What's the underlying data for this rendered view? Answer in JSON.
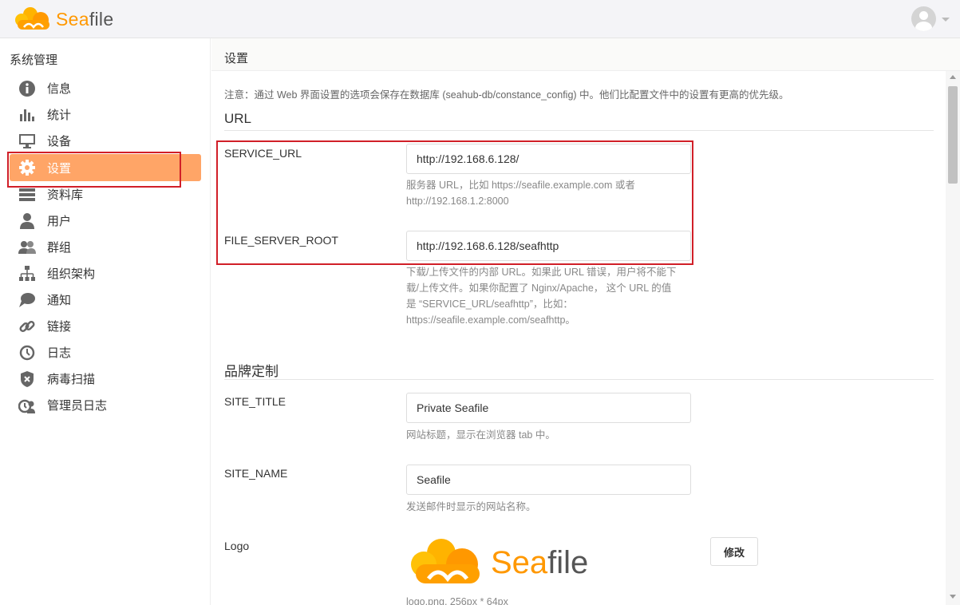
{
  "app": {
    "name_prefix": "Sea",
    "name_suffix": "file"
  },
  "sidebar": {
    "heading": "系统管理",
    "items": [
      {
        "label": "信息",
        "icon": "info-icon"
      },
      {
        "label": "统计",
        "icon": "bar-chart-icon"
      },
      {
        "label": "设备",
        "icon": "monitor-icon"
      },
      {
        "label": "设置",
        "icon": "gear-icon",
        "active": true
      },
      {
        "label": "资料库",
        "icon": "library-icon"
      },
      {
        "label": "用户",
        "icon": "user-icon"
      },
      {
        "label": "群组",
        "icon": "group-icon"
      },
      {
        "label": "组织架构",
        "icon": "org-chart-icon"
      },
      {
        "label": "通知",
        "icon": "notification-icon"
      },
      {
        "label": "链接",
        "icon": "link-icon"
      },
      {
        "label": "日志",
        "icon": "history-icon"
      },
      {
        "label": "病毒扫描",
        "icon": "shield-icon"
      },
      {
        "label": "管理员日志",
        "icon": "admin-log-icon"
      }
    ]
  },
  "main": {
    "title": "设置",
    "notice": "注意：通过 Web 界面设置的选项会保存在数据库 (seahub-db/constance_config) 中。他们比配置文件中的设置有更高的优先级。",
    "url_section": {
      "title": "URL",
      "service_url": {
        "label": "SERVICE_URL",
        "value": "http://192.168.6.128/",
        "help_1": "服务器 URL，比如 https://seafile.example.com 或者",
        "help_2": "http://192.168.1.2:8000"
      },
      "file_server_root": {
        "label": "FILE_SERVER_ROOT",
        "value": "http://192.168.6.128/seafhttp",
        "help_1": "下载/上传文件的内部 URL。如果此 URL 错误，用户将不能下",
        "help_2": "载/上传文件。如果你配置了 Nginx/Apache， 这个 URL 的值",
        "help_3": "是 “SERVICE_URL/seafhttp”，比如：",
        "help_4": "https://seafile.example.com/seafhttp。"
      }
    },
    "branding_section": {
      "title": "品牌定制",
      "site_title": {
        "label": "SITE_TITLE",
        "value": "Private Seafile",
        "help": "网站标题，显示在浏览器 tab 中。"
      },
      "site_name": {
        "label": "SITE_NAME",
        "value": "Seafile",
        "help": "发送邮件时显示的网站名称。"
      },
      "logo": {
        "label": "Logo",
        "button": "修改",
        "help": "logo.png, 256px * 64px"
      }
    }
  },
  "colors": {
    "accent": "#ffa567",
    "brand": "#ff9800",
    "highlight": "#d11f28"
  }
}
